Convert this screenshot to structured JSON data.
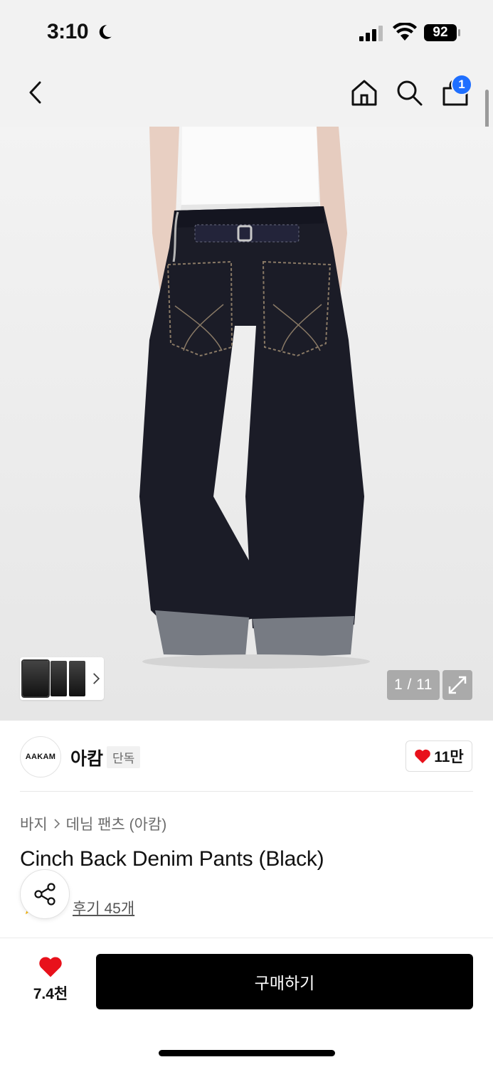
{
  "status_bar": {
    "time": "3:10",
    "battery": "92",
    "icons": [
      "moon-icon",
      "signal-icon",
      "wifi-icon",
      "battery-icon"
    ]
  },
  "nav": {
    "icons": [
      "back-chevron-icon",
      "home-icon",
      "search-icon",
      "shopping-bag-icon"
    ],
    "cart_badge": "1"
  },
  "gallery": {
    "counter": "1 / 11",
    "icons": [
      "chevron-right-icon",
      "expand-icon"
    ]
  },
  "brand": {
    "logo_text": "AAKAM",
    "name": "아캄",
    "tag": "단독",
    "likes": "11만"
  },
  "product": {
    "breadcrumb": [
      "바지",
      "데님 팬츠 (아캄)"
    ],
    "title": "Cinch Back Denim Pants (Black)",
    "review_link": "후기 45개"
  },
  "bottom_bar": {
    "wish_count": "7.4천",
    "buy_label": "구매하기"
  },
  "colors": {
    "accent_badge": "#1f6fff",
    "heart": "#e8111b",
    "buy_button": "#000000",
    "star": "#f5b301"
  }
}
